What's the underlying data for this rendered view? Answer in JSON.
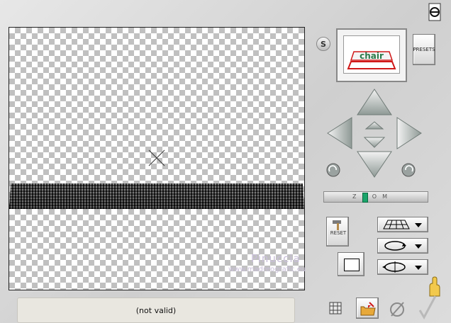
{
  "canvas": {},
  "status": {
    "text": "(not valid)"
  },
  "watermark": {
    "line1": "Pinuccia",
    "line2": "www.madreografic.eu"
  },
  "preview": {
    "label": "chair"
  },
  "buttons": {
    "s_label": "S",
    "presets_label": "PRESETS",
    "reset_label": "RESET"
  },
  "zoom": {
    "label": "ZOOM",
    "level": 0.4
  },
  "icons": {
    "e_icon": "e-logo-icon",
    "hand": "pointing-hand-icon",
    "grid": "grid-icon",
    "folder": "open-folder-icon",
    "none": "no-symbol-icon",
    "ok": "checkmark-icon"
  },
  "colors": {
    "zoom_thumb": "#1aa46a",
    "accent_red": "#d01818"
  }
}
